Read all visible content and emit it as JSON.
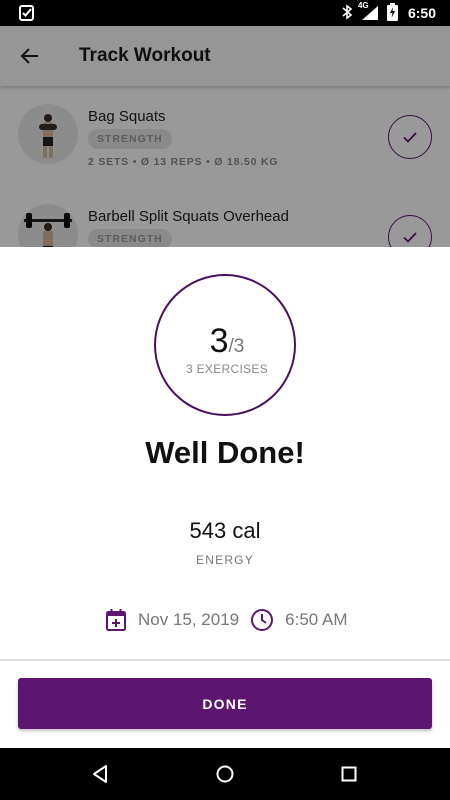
{
  "status_bar": {
    "time": "6:50",
    "network": "4G",
    "icons": [
      "app-notification-icon",
      "bluetooth-icon",
      "signal-icon",
      "battery-charging-icon"
    ]
  },
  "app_bar": {
    "title": "Track Workout",
    "back_icon": "arrow-back-icon"
  },
  "exercises": [
    {
      "name": "Bag Squats",
      "category": "STRENGTH",
      "stats": "2 SETS • Ø 13 REPS  • Ø 18.50 KG",
      "check_icon": "check-icon"
    },
    {
      "name": "Barbell Split Squats Overhead",
      "category": "STRENGTH",
      "check_icon": "check-icon"
    }
  ],
  "summary": {
    "completed": "3",
    "total": "/3",
    "exercises_label": "3 EXERCISES",
    "headline": "Well Done!",
    "energy_value": "543 cal",
    "energy_label": "ENERGY",
    "date": "Nov 15, 2019",
    "time": "6:50 AM",
    "date_icon": "calendar-add-icon",
    "time_icon": "clock-icon"
  },
  "done_button": {
    "label": "DONE"
  },
  "nav_bar": {
    "icons": [
      "back-triangle-icon",
      "home-circle-icon",
      "recents-square-icon"
    ]
  },
  "colors": {
    "accent": "#5c166f",
    "ring": "#4a1060",
    "muted_text": "#777777"
  }
}
